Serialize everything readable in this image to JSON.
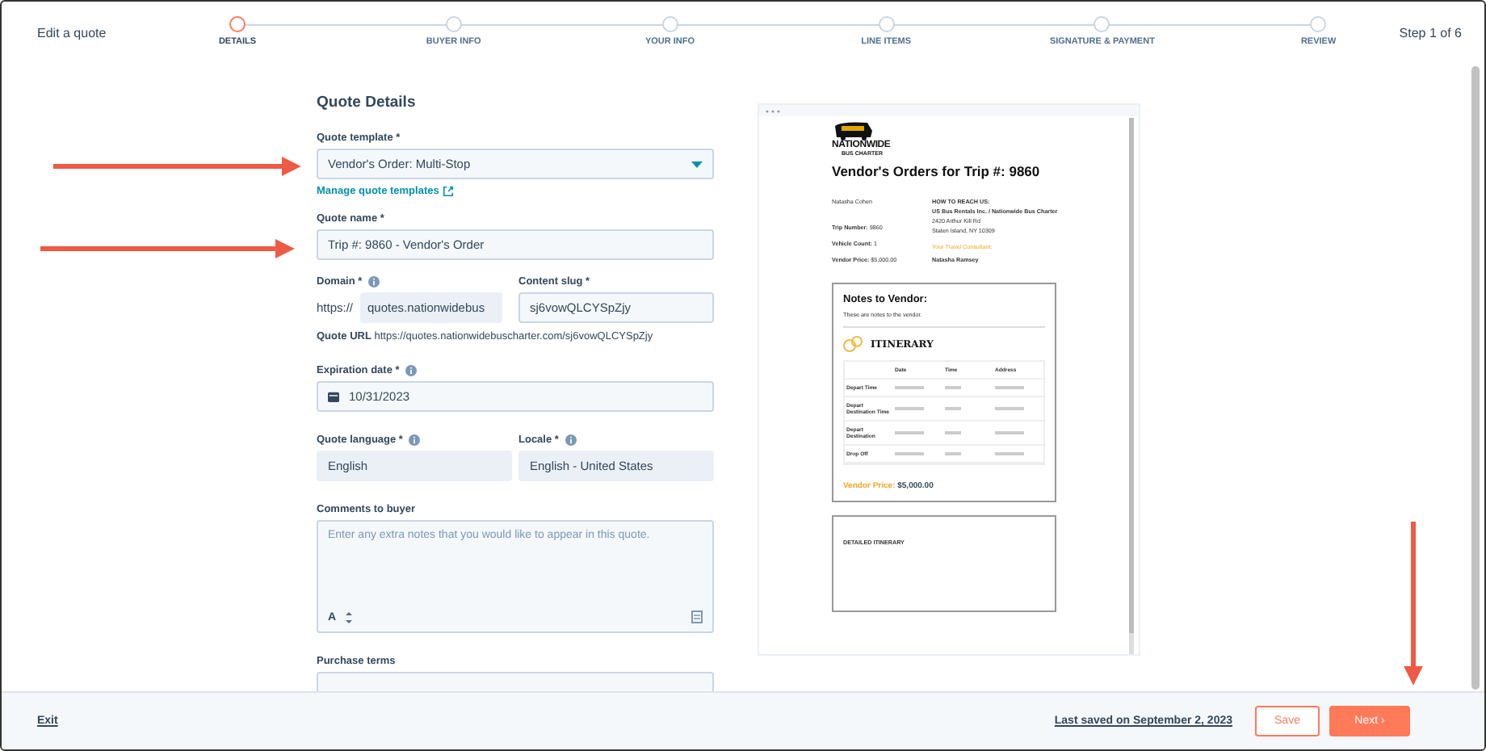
{
  "header": {
    "title": "Edit a quote",
    "step_count": "Step 1 of 6"
  },
  "steps": [
    {
      "label": "DETAILS",
      "selected": true
    },
    {
      "label": "BUYER INFO",
      "selected": false
    },
    {
      "label": "YOUR INFO",
      "selected": false
    },
    {
      "label": "LINE ITEMS",
      "selected": false
    },
    {
      "label": "SIGNATURE & PAYMENT",
      "selected": false
    },
    {
      "label": "REVIEW",
      "selected": false
    }
  ],
  "form": {
    "heading": "Quote Details",
    "template": {
      "label": "Quote template *",
      "value": "Vendor's Order: Multi-Stop",
      "link": "Manage quote templates"
    },
    "name": {
      "label": "Quote name *",
      "value": "Trip #: 9860 - Vendor's Order"
    },
    "domain": {
      "label": "Domain *",
      "info": true,
      "prefix": "https://",
      "value": "quotes.nationwidebus"
    },
    "slug": {
      "label": "Content slug *",
      "info": false,
      "value": "sj6vowQLCYSpZjy"
    },
    "quote_url": {
      "label": "Quote URL",
      "value": "https://quotes.nationwidebuscharter.com/sj6vowQLCYSpZjy"
    },
    "expiration": {
      "label": "Expiration date *",
      "info": true,
      "value": "10/31/2023"
    },
    "language": {
      "label": "Quote language *",
      "info": true,
      "value": "English"
    },
    "locale": {
      "label": "Locale *",
      "info": true,
      "value": "English - United States"
    },
    "comments": {
      "label": "Comments to buyer",
      "placeholder": "Enter any extra notes that you would like to appear in this quote.",
      "tool": "A"
    },
    "purchase_terms": {
      "label": "Purchase terms"
    }
  },
  "preview": {
    "logo": "NATIONWIDE",
    "logo_sub": "BUS CHARTER",
    "title": "Vendor's Orders for Trip #: 9860",
    "left": [
      "Natasha Cohen",
      "**Trip Number:** 9860",
      "**Vehicle Count:** 1",
      "**Vendor Price:** $5,000.00"
    ],
    "right_heading": "HOW TO REACH US:",
    "company": "US Bus Rentals Inc. / Nationwide Bus Charter",
    "address": [
      "2420 Arthur Kill Rd",
      "Staten Island, NY 10309"
    ],
    "consultant_heading": "Your Travel Consultant:",
    "consultant": "Natasha Ramsey",
    "notes_heading": "Notes to Vendor:",
    "notes": "These are notes to the vendor.",
    "itinerary_heading": "ITINERARY",
    "itinerary_columns": [
      "Date",
      "Time",
      "Address"
    ],
    "itinerary_rows": [
      "Depart Time",
      "Depart Destination Time",
      "Depart Destination",
      "Drop Off"
    ],
    "price_label": "Vendor Price:",
    "price": "$5,000.00",
    "detailed_heading": "DETAILED ITINERARY"
  },
  "footer": {
    "exit": "Exit",
    "last_saved": "Last saved on September 2, 2023",
    "save": "Save",
    "next": "Next",
    "next_icon": "›"
  }
}
